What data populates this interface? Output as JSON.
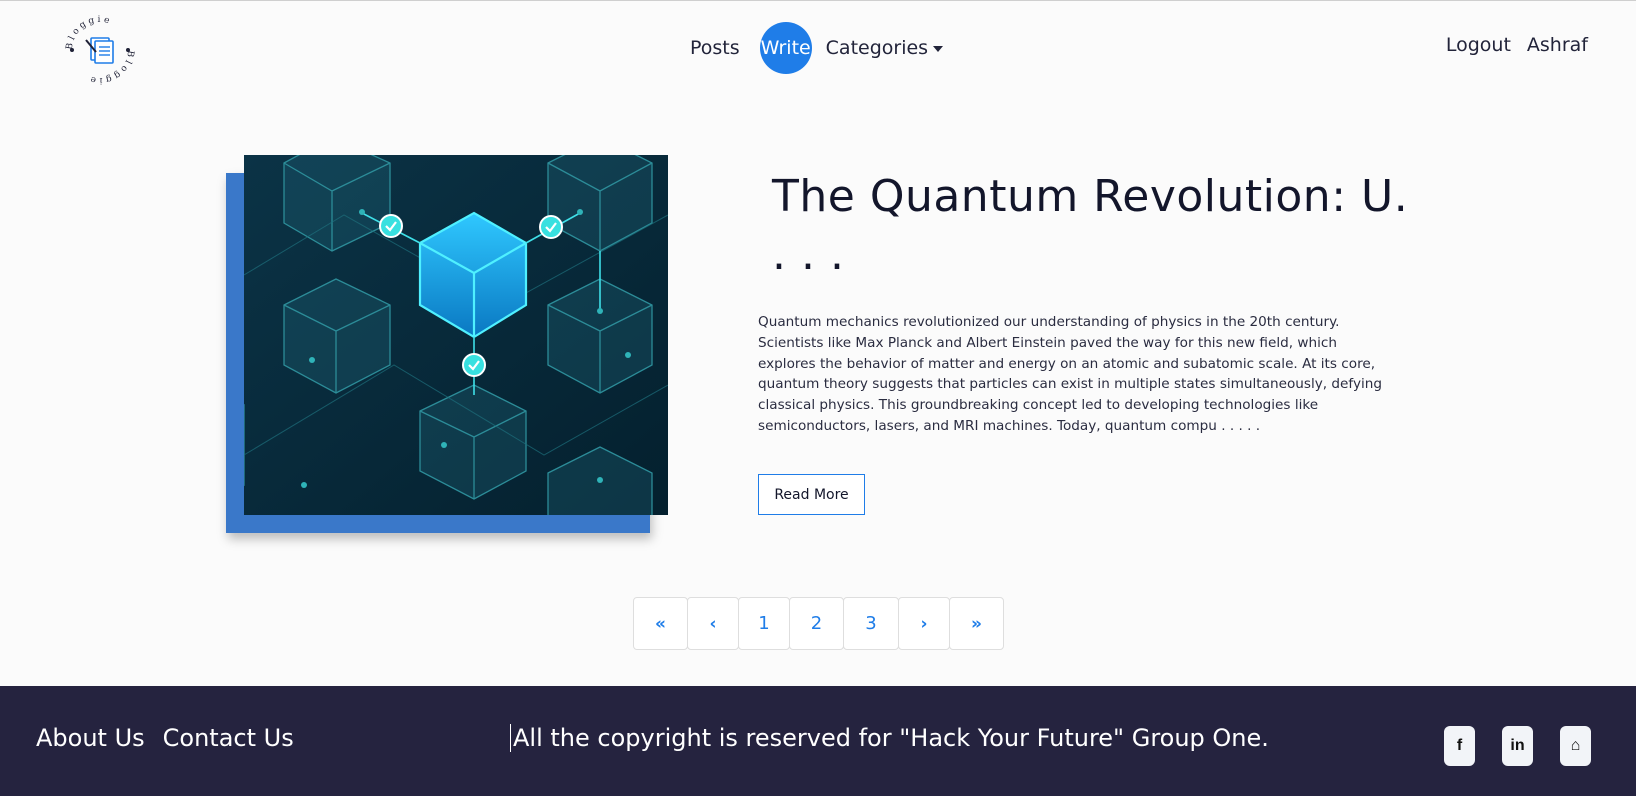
{
  "header": {
    "logo_text": "Bloggie",
    "nav": {
      "posts": "Posts",
      "write": "Write",
      "categories": "Categories"
    },
    "right": {
      "logout": "Logout",
      "user": "Ashraf"
    },
    "accent": "#1f7de8"
  },
  "post": {
    "title": "The Quantum Revolution: U. . . .",
    "excerpt": "Quantum mechanics revolutionized our understanding of physics in the 20th century. Scientists like Max Planck and Albert Einstein paved the way for this new field, which explores the behavior of matter and energy on an atomic and subatomic scale. At its core, quantum theory suggests that particles can exist in multiple states simultaneously, defying classical physics. This groundbreaking concept led to developing technologies like semiconductors, lasers, and MRI machines. Today, quantum compu . . . . .",
    "read_more": "Read More"
  },
  "pagination": {
    "first": "«",
    "prev": "‹",
    "pages": [
      "1",
      "2",
      "3"
    ],
    "next": "›",
    "last": "»"
  },
  "footer": {
    "about": "About Us",
    "contact": "Contact Us",
    "copyright": "All the copyright is reserved for \"Hack Your Future\" Group One.",
    "socials": [
      {
        "icon": "facebook-icon",
        "glyph": "f"
      },
      {
        "icon": "linkedin-icon",
        "glyph": "in"
      },
      {
        "icon": "github-icon",
        "glyph": "⌂"
      }
    ],
    "background": "#25233f"
  }
}
